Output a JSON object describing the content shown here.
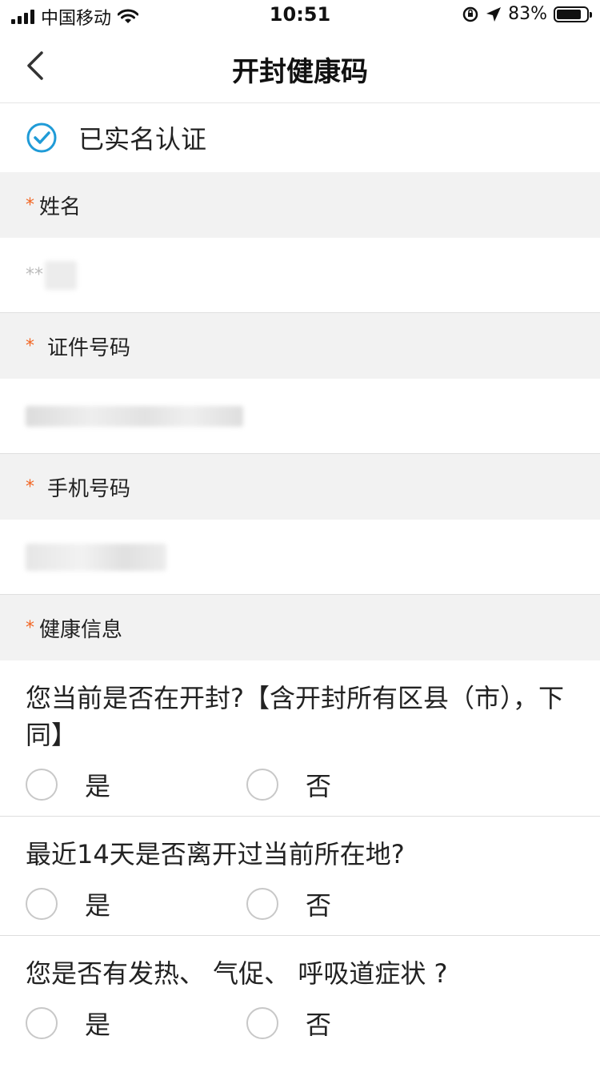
{
  "status_bar": {
    "carrier": "中国移动",
    "time": "10:51",
    "battery_percent": "83%",
    "battery_level": 0.83
  },
  "nav": {
    "title": "开封健康码"
  },
  "verification": {
    "text": "已实名认证"
  },
  "fields": {
    "name": {
      "label": "姓名",
      "value_mask": "**"
    },
    "id_number": {
      "label": "证件号码"
    },
    "phone": {
      "label": "手机号码"
    }
  },
  "health": {
    "label": "健康信息",
    "questions": [
      {
        "text": "您当前是否在开封?【含开封所有区县（市），下同】",
        "yes": "是",
        "no": "否"
      },
      {
        "text": "最近14天是否离开过当前所在地?",
        "yes": "是",
        "no": "否"
      },
      {
        "text": "您是否有发热、 气促、 呼吸道症状 ?",
        "yes": "是",
        "no": "否"
      }
    ]
  },
  "colors": {
    "accent_check": "#1f9bd7",
    "required_mark": "#f26522",
    "section_bg": "#f2f2f2"
  },
  "icons": [
    "back-chevron-icon",
    "check-circle-icon",
    "wifi-icon",
    "location-arrow-icon",
    "rotation-lock-icon"
  ]
}
